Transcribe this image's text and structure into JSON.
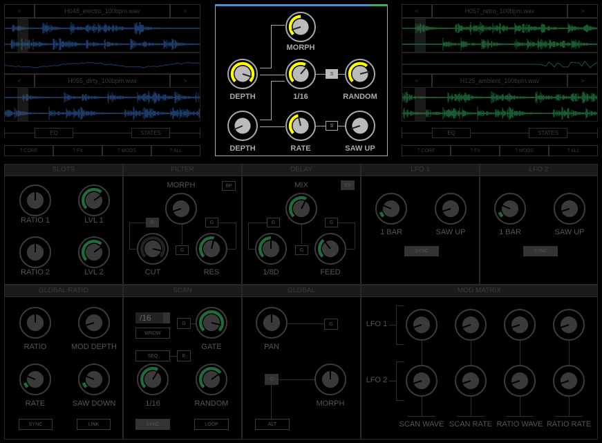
{
  "colors": {
    "blue_wave": "#1c3a66",
    "green_wave": "#1a5a30",
    "yellow_arc": "#ffff00",
    "green_arc": "#1f6b3a",
    "accent_blue": "#4a8fd8",
    "accent_green": "#3fae5a"
  },
  "left_deck": {
    "prev": "<",
    "next": ">",
    "file1": "H048_electro_100bpm.wav",
    "file2": "H055_dirty_100bpm.wav",
    "eq": "EQ",
    "states": "STATES",
    "help": [
      "? CORE",
      "? FX",
      "? MODS",
      "? ALL"
    ]
  },
  "right_deck": {
    "prev": "<",
    "next": ">",
    "file1": "H057_retro_100bpm.wav",
    "file2": "H125_ambient_100bpm.wav",
    "eq": "EQ",
    "states": "STATES",
    "help": [
      "? CORE",
      "? FX",
      "? MODS",
      "? ALL"
    ]
  },
  "center": {
    "knobs": [
      {
        "label": "MORPH",
        "value": 0.1,
        "mod": 0.5
      },
      {
        "label": "DEPTH",
        "value": 0.9,
        "mod": 1.0
      },
      {
        "label": "1/16",
        "value": 0.65,
        "mod": 0.6
      },
      {
        "label": "RANDOM",
        "value": 0.78,
        "mod": 0.65
      },
      {
        "label": "DEPTH",
        "value": 0.08,
        "mod": 0
      },
      {
        "label": "RATE",
        "value": 0.45,
        "mod": 0.45
      },
      {
        "label": "SAW UP",
        "value": 0.1,
        "mod": 0
      }
    ],
    "s1": "S",
    "s2": "S"
  },
  "slots": {
    "title": "SLOTS",
    "knobs": [
      {
        "label": "RATIO 1",
        "value": 0.5,
        "mod": 0
      },
      {
        "label": "LVL 1",
        "value": 0.7,
        "mod": 0.65
      },
      {
        "label": "RATIO 2",
        "value": 0.5,
        "mod": 0
      },
      {
        "label": "LVL 2",
        "value": 0.7,
        "mod": 0.65
      }
    ]
  },
  "filter": {
    "title": "FILTER",
    "mode": "BP",
    "g": "G",
    "knobs": [
      {
        "label": "MORPH",
        "value": 0.1,
        "mod": 0
      },
      {
        "label": "CUT",
        "value": 0.88,
        "mod": 1.0,
        "arc": "grey"
      },
      {
        "label": "RES",
        "value": 0.55,
        "mod": 0.55
      }
    ]
  },
  "delay": {
    "title": "DELAY",
    "mode": "SY",
    "g": "G",
    "knobs": [
      {
        "label": "MIX",
        "value": 0.6,
        "mod": 0.6
      },
      {
        "label": "1/8D",
        "value": 0.5,
        "mod": 0.5
      },
      {
        "label": "FEED",
        "value": 0.36,
        "mod": 0.36
      }
    ]
  },
  "lfo1": {
    "title": "LFO 1",
    "sync": "SYNC",
    "knobs": [
      {
        "label": "1 BAR",
        "value": 0.25,
        "mod": 0.1
      },
      {
        "label": "SAW UP",
        "value": 0.1,
        "mod": 0
      }
    ]
  },
  "lfo2": {
    "title": "LFO 2",
    "sync": "SYNC",
    "knobs": [
      {
        "label": "1 BAR",
        "value": 0.25,
        "mod": 0.1
      },
      {
        "label": "SAW UP",
        "value": 0.1,
        "mod": 0
      }
    ]
  },
  "global_ratio": {
    "title": "GLOBAL RATIO",
    "sync": "SYNC",
    "link": "LINK",
    "knobs": [
      {
        "label": "RATIO",
        "value": 0.5,
        "mod": 0
      },
      {
        "label": "MOD DEPTH",
        "value": 0.1,
        "mod": 0
      },
      {
        "label": "RATE",
        "value": 0.25,
        "mod": 0.1
      },
      {
        "label": "SAW DOWN",
        "value": 0.25,
        "mod": 0.1
      }
    ]
  },
  "scan": {
    "title": "SCAN",
    "division": "/16",
    "wndw": "WNDW",
    "seq": "SEQ",
    "g": "G",
    "e": "E",
    "sync": "SYNC",
    "loop": "LOOP",
    "knobs": [
      {
        "label": "GATE",
        "value": 0.88,
        "mod": 1.0
      },
      {
        "label": "1/16",
        "value": 0.62,
        "mod": 0.6
      },
      {
        "label": "RANDOM",
        "value": 0.7,
        "mod": 0.7
      }
    ]
  },
  "global": {
    "title": "GLOBAL",
    "g": "G",
    "alt": "ALT",
    "knobs": [
      {
        "label": "PAN",
        "value": 0.5,
        "mod": 0
      },
      {
        "label": "MORPH",
        "value": 0.5,
        "mod": 0
      }
    ]
  },
  "mod_matrix": {
    "title": "MOD MATRIX",
    "rows": [
      "LFO 1",
      "LFO 2"
    ],
    "columns": [
      "SCAN WAVE",
      "SCAN RATE",
      "RATIO WAVE",
      "RATIO RATE"
    ],
    "knobs": [
      {
        "value": 0.1,
        "mod": 0
      },
      {
        "value": 0.1,
        "mod": 0
      },
      {
        "value": 0.1,
        "mod": 0
      },
      {
        "value": 0.1,
        "mod": 0
      },
      {
        "value": 0.1,
        "mod": 0
      },
      {
        "value": 0.1,
        "mod": 0
      },
      {
        "value": 0.1,
        "mod": 0
      },
      {
        "value": 0.1,
        "mod": 0
      }
    ]
  }
}
